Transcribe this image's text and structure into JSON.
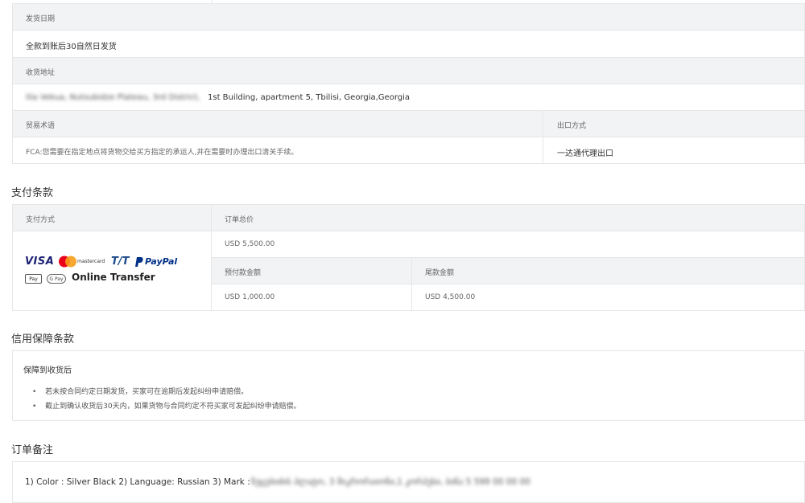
{
  "delivery": {
    "date_label": "发货日期",
    "date_value": "全款到账后30自然日发货",
    "address_label": "收货地址",
    "address_blurred": "Ilia Vekua, Nutsubidze Plateau, 3rd District,",
    "address_visible": "1st Building, apartment 5, Tbilisi, Georgia,Georgia",
    "trade_terms_label": "贸易术语",
    "trade_terms_value": "FCA:您需要在指定地点将货物交给买方指定的承运人,并在需要时办理出口清关手续。",
    "export_label": "出口方式",
    "export_value": "一达通代理出口"
  },
  "payment": {
    "section_title": "支付条款",
    "method_label": "支付方式",
    "total_label": "订单总价",
    "total_value": "USD 5,500.00",
    "deposit_label": "预付款金额",
    "deposit_value": "USD 1,000.00",
    "balance_label": "尾款金额",
    "balance_value": "USD 4,500.00",
    "logos": {
      "visa": "VISA",
      "mastercard": "mastercard",
      "tt": "T/T",
      "paypal": "PayPal",
      "applepay": "Pay",
      "gpay": "G Pay",
      "online_transfer": "Online Transfer"
    }
  },
  "credit": {
    "section_title": "信用保障条款",
    "guarantee_title": "保障到收货后",
    "items": [
      "若未按合同约定日期发货，买家可在逾期后发起纠纷申请赔偿。",
      "截止到确认收货后30天内，如果货物与合同约定不符买家可发起纠纷申请赔偿。"
    ]
  },
  "remarks": {
    "section_title": "订单备注",
    "text_visible": "1) Color : Silver Black 2) Language: Russian 3) Mark :",
    "text_blurred": "ნუცუბიძის პლატო, 3 მიკრორაიონი,1 კორპუსი, ბინა 5 599 00 00 00"
  },
  "colors": {
    "header_bg": "#f2f3f5",
    "border": "#e6e6e6",
    "visa_blue": "#1a1f71",
    "mc_red": "#eb001b",
    "mc_orange": "#f79e1b",
    "paypal_blue": "#003087",
    "paypal_light": "#009cde"
  }
}
